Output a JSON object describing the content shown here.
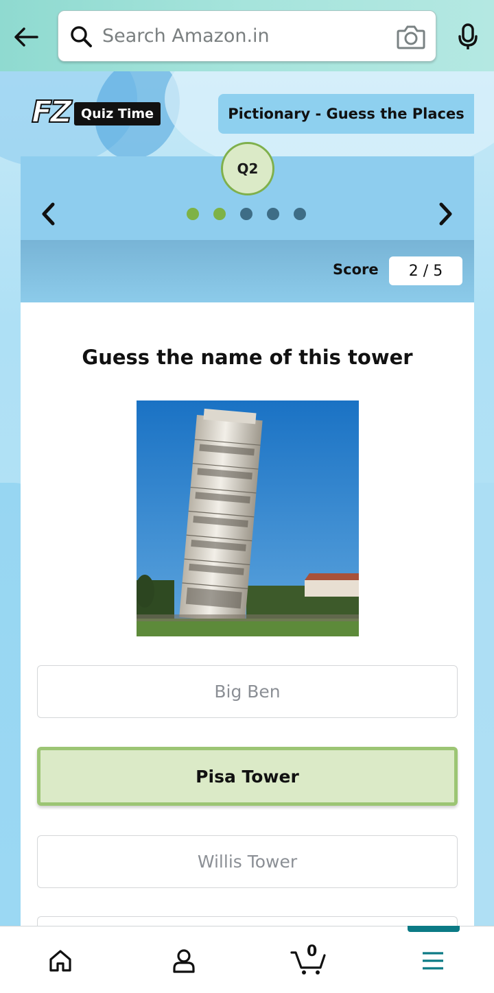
{
  "header": {
    "search_placeholder": "Search Amazon.in",
    "icons": [
      "back-arrow-icon",
      "search-icon",
      "camera-icon",
      "microphone-icon"
    ]
  },
  "quiz": {
    "logo_mark": "FZ",
    "logo_text": "Quiz Time",
    "category": "Pictionary - Guess the Places",
    "question_badge": "Q2",
    "progress_dots": [
      {
        "state": "done"
      },
      {
        "state": "done"
      },
      {
        "state": "pending"
      },
      {
        "state": "pending"
      },
      {
        "state": "pending"
      }
    ],
    "score_label": "Score",
    "score_value": "2 / 5",
    "question": "Guess the name of this tower",
    "options": [
      {
        "label": "Big Ben",
        "state": "default"
      },
      {
        "label": "Pisa Tower",
        "state": "correct"
      },
      {
        "label": "Willis Tower",
        "state": "default"
      },
      {
        "label": "",
        "state": "default"
      }
    ]
  },
  "bottom_nav": {
    "cart_count": "0",
    "items": [
      "home-icon",
      "account-icon",
      "cart-icon",
      "menu-icon"
    ],
    "active": "menu"
  },
  "colors": {
    "accent_teal": "#0b7a85",
    "correct_fill": "#dbeac7",
    "correct_border": "#9cc574",
    "dot_done": "#7eb246",
    "dot_pending": "#3e6d86"
  }
}
